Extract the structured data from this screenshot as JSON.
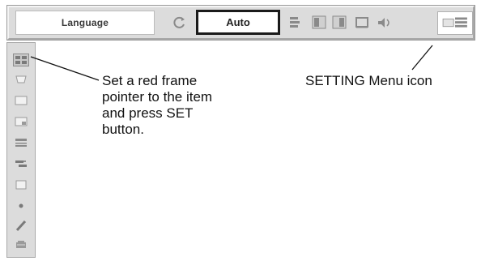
{
  "menu": {
    "title": "Language",
    "current_value": "Auto"
  },
  "toolbar_icons": [
    "rotate-icon",
    "keystone-icon",
    "screen-left-icon",
    "screen-right-icon",
    "screen-icon",
    "sound-icon",
    "setting-icon"
  ],
  "sidebar_icons": [
    "language-icon",
    "keystone-icon",
    "blue-back-icon",
    "display-icon",
    "logo-icon",
    "ceiling-icon",
    "rear-icon",
    "terminal-icon",
    "power-management-icon",
    "filter-icon"
  ],
  "annotations": {
    "left_callout": "Set a red frame\npointer to the item\nand press SET\nbutton.",
    "right_callout": "SETTING Menu icon"
  }
}
